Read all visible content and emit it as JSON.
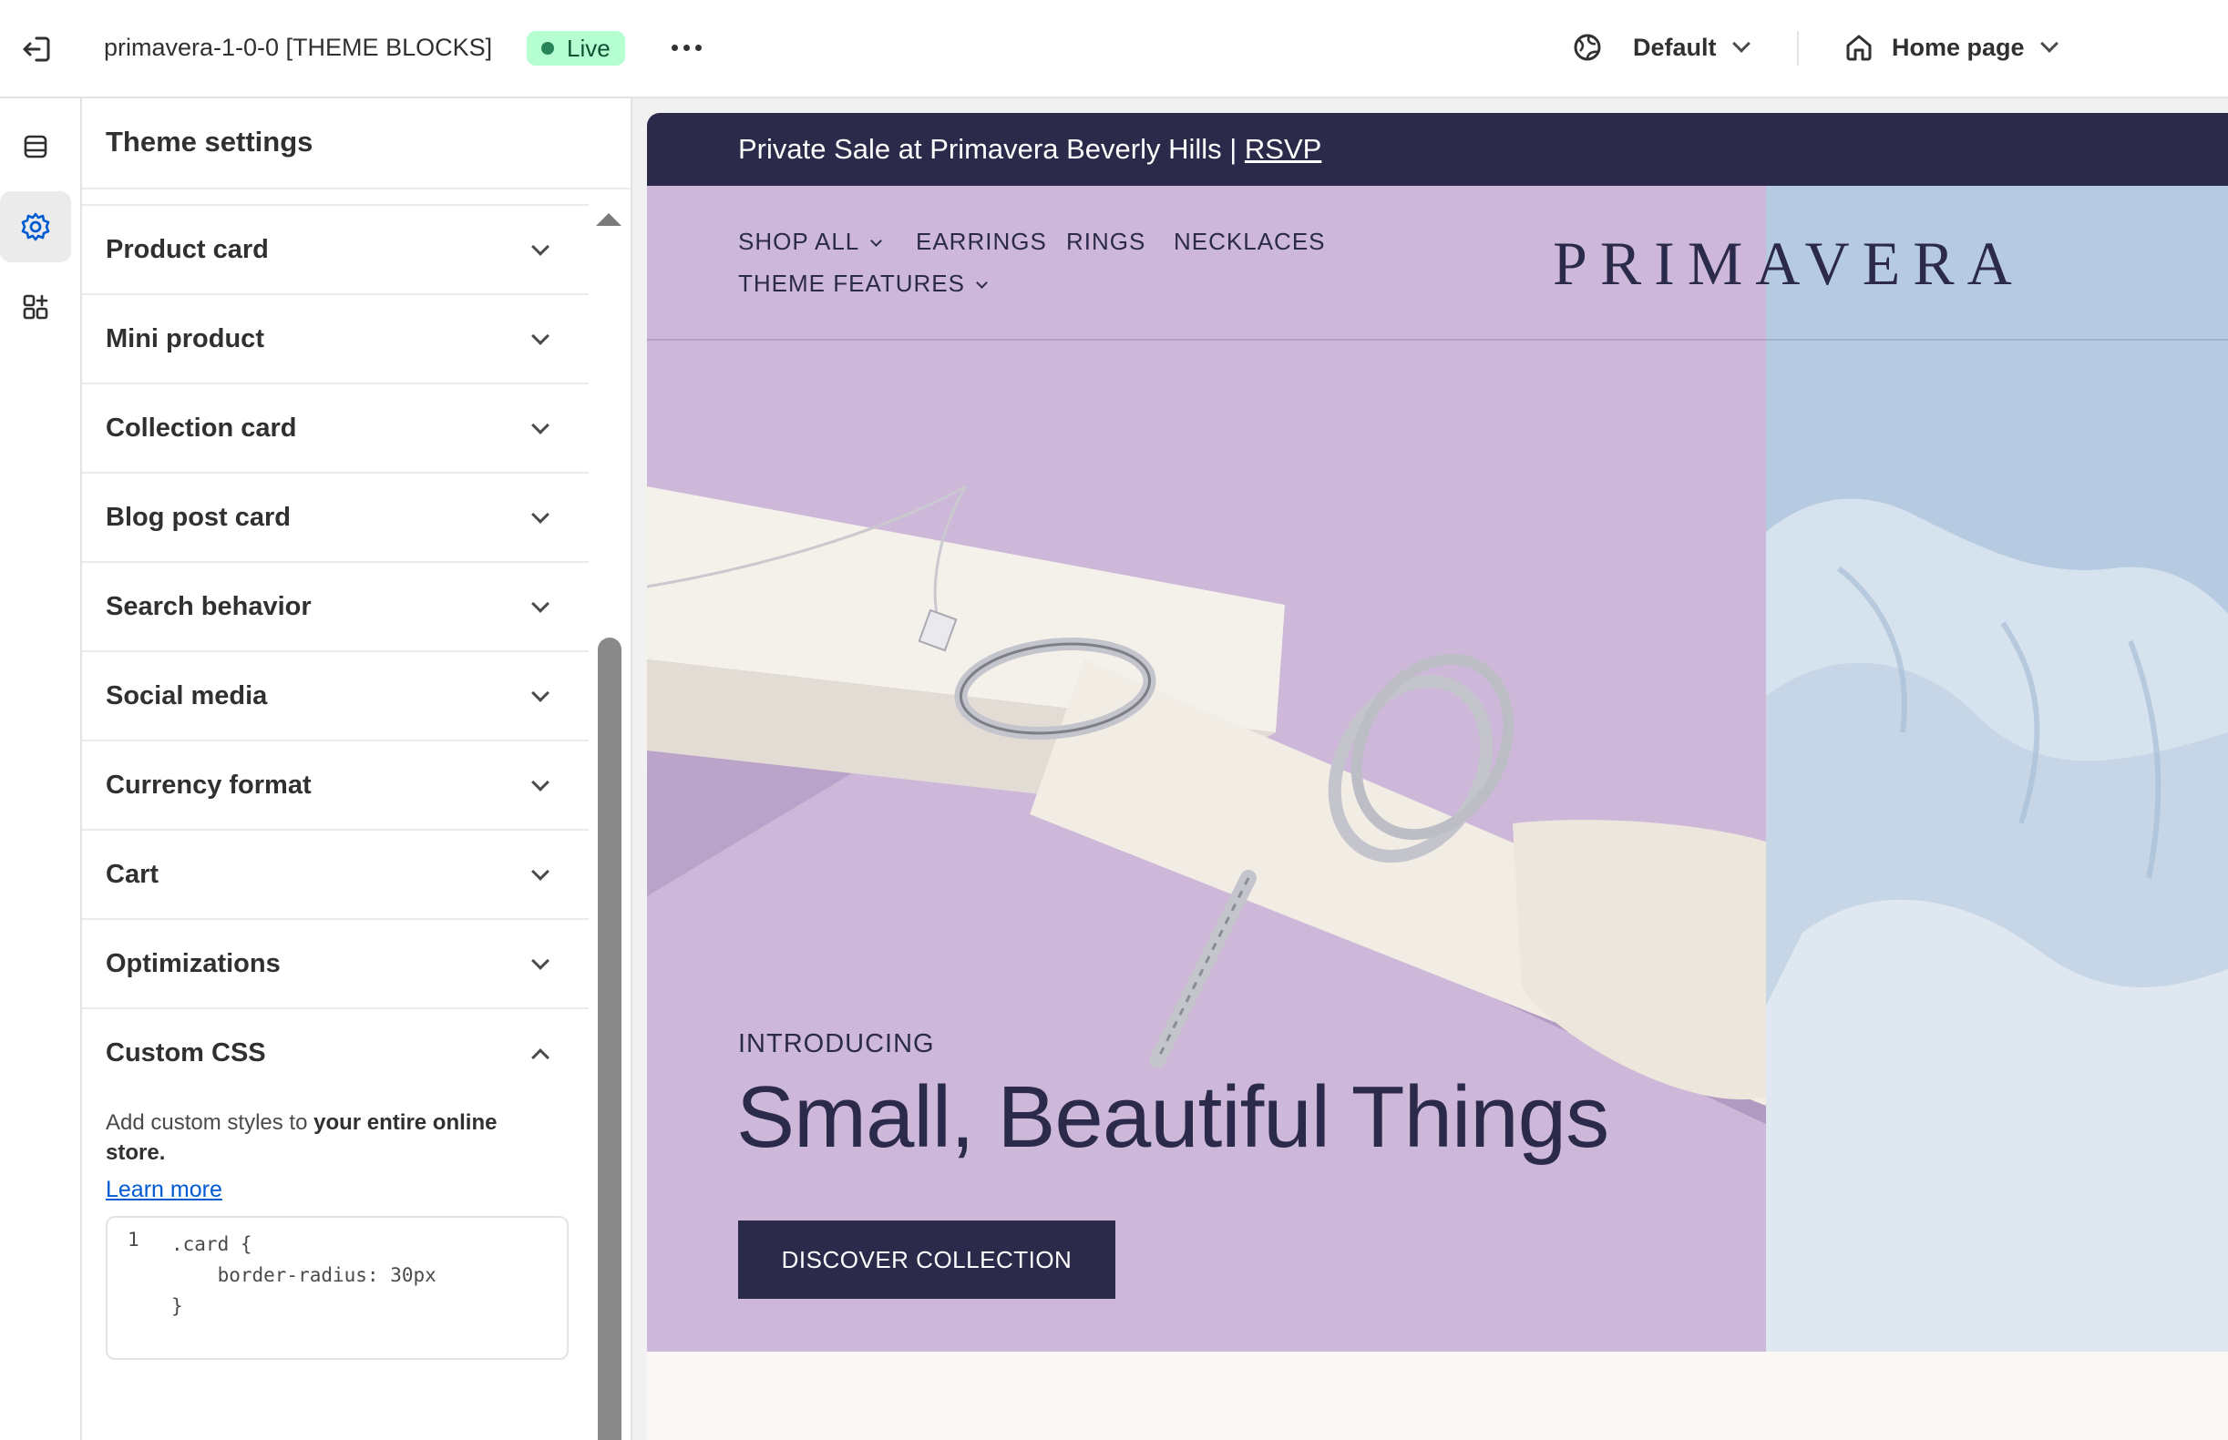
{
  "topbar": {
    "theme_name": "primavera-1-0-0 [THEME BLOCKS]",
    "status_badge": "Live",
    "language_select": "Default",
    "page_select": "Home page"
  },
  "panel": {
    "title": "Theme settings",
    "items": [
      {
        "label": "Product card"
      },
      {
        "label": "Mini product"
      },
      {
        "label": "Collection card"
      },
      {
        "label": "Blog post card"
      },
      {
        "label": "Search behavior"
      },
      {
        "label": "Social media"
      },
      {
        "label": "Currency format"
      },
      {
        "label": "Cart"
      },
      {
        "label": "Optimizations"
      },
      {
        "label": "Custom CSS"
      }
    ],
    "custom_css": {
      "desc_prefix": "Add custom styles to ",
      "desc_bold": "your entire online store.",
      "learn_more": "Learn more",
      "line_number": "1",
      "code": ".card {\n    border-radius: 30px\n}"
    }
  },
  "preview": {
    "announcement_text": "Private Sale at Primavera Beverly Hills | ",
    "announcement_link": "RSVP",
    "nav": {
      "shop_all": "SHOP ALL",
      "earrings": "EARRINGS",
      "rings": "RINGS",
      "necklaces": "NECKLACES",
      "theme_features": "THEME FEATURES"
    },
    "logo": "PRIMAVERA",
    "eyebrow": "INTRODUCING",
    "headline": "Small, Beautiful Things",
    "cta": "DISCOVER COLLECTION"
  },
  "colors": {
    "brand_dark": "#2c2a4a",
    "live_badge_bg": "#b4fed2",
    "link_blue": "#005bd3",
    "hero_lilac": "#cdb8d9",
    "hero_sky": "#b9cde3"
  },
  "icons": {
    "exit": "exit-icon",
    "more": "more-horizontal-icon",
    "language": "globe-icon",
    "home": "home-icon",
    "sections": "sections-icon",
    "settings": "gear-icon",
    "apps": "apps-add-icon"
  }
}
